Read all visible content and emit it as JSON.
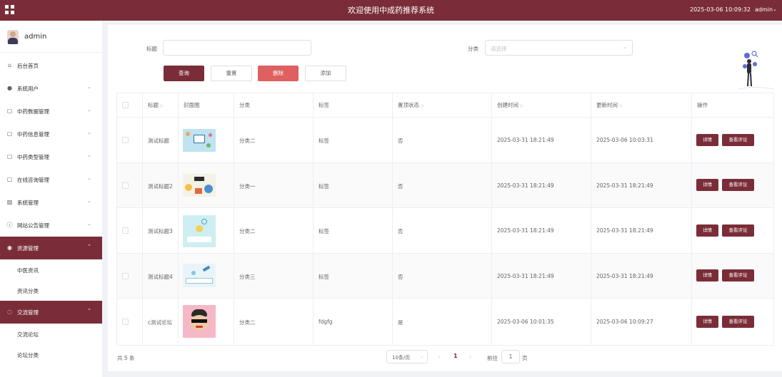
{
  "header": {
    "title": "欢迎使用中成药推荐系统",
    "datetime": "2025-03-06 10:09:32",
    "user": "admin",
    "user_caret": "⌄"
  },
  "sidebar": {
    "username": "admin",
    "items": [
      {
        "label": "后台首页",
        "icon": "home-icon",
        "glyph": "⌂",
        "arrow": ""
      },
      {
        "label": "系统用户",
        "icon": "user-icon",
        "glyph": "●",
        "arrow": "⌄"
      },
      {
        "label": "中药数据管理",
        "icon": "doc-icon",
        "glyph": "▢",
        "arrow": "⌄"
      },
      {
        "label": "中药信息管理",
        "icon": "doc-icon",
        "glyph": "▢",
        "arrow": "⌄"
      },
      {
        "label": "中药类型管理",
        "icon": "doc-icon",
        "glyph": "▢",
        "arrow": "⌄"
      },
      {
        "label": "在线咨询管理",
        "icon": "doc-icon",
        "glyph": "▢",
        "arrow": "⌄"
      },
      {
        "label": "系统管理",
        "icon": "chart-icon",
        "glyph": "▨",
        "arrow": "⌄"
      },
      {
        "label": "网站公告管理",
        "icon": "info-icon",
        "glyph": "ⓘ",
        "arrow": "⌄"
      },
      {
        "label": "资源管理",
        "icon": "location-icon",
        "glyph": "◉",
        "arrow": "⌃",
        "active": true
      },
      {
        "label": "中医资讯",
        "sub": true
      },
      {
        "label": "资讯分类",
        "sub": true
      },
      {
        "label": "交流管理",
        "icon": "chat-icon",
        "glyph": "◌",
        "arrow": "⌃",
        "active": true
      },
      {
        "label": "交流论坛",
        "sub": true
      },
      {
        "label": "论坛分类",
        "sub": true
      }
    ]
  },
  "search": {
    "title_label": "标题",
    "title_value": "",
    "category_label": "分类",
    "category_placeholder": "请选择"
  },
  "toolbar": {
    "query": "查询",
    "reset": "重置",
    "delete": "删除",
    "add": "添加"
  },
  "table": {
    "headers": {
      "title": "标题",
      "cover": "封面图",
      "category": "分类",
      "tags": "标签",
      "top": "置顶状态",
      "created": "创建时间",
      "updated": "更新时间",
      "actions": "操作"
    },
    "rows": [
      {
        "title": "测试标题",
        "category": "分类二",
        "tags": "标签",
        "top": "否",
        "created": "2025-03-31 18:21:49",
        "updated": "2025-03-06 10:03:31"
      },
      {
        "title": "测试标题2",
        "category": "分类一",
        "tags": "标签",
        "top": "否",
        "created": "2025-03-31 18:21:49",
        "updated": "2025-03-31 18:21:49"
      },
      {
        "title": "测试标题3",
        "category": "分类二",
        "tags": "标签",
        "top": "否",
        "created": "2025-03-31 18:21:49",
        "updated": "2025-03-31 18:21:49"
      },
      {
        "title": "测试标题4",
        "category": "分类三",
        "tags": "标签",
        "top": "否",
        "created": "2025-03-31 18:21:49",
        "updated": "2025-03-31 18:21:49"
      },
      {
        "title": "c测试论坛",
        "category": "分类二",
        "tags": "fdgfg",
        "top": "是",
        "created": "2025-03-06 10:01:35",
        "updated": "2025-03-06 10:09:27"
      }
    ],
    "detail_btn": "详情",
    "comments_btn": "查看评论"
  },
  "pagination": {
    "total": "共 5 条",
    "page_size": "10条/页",
    "prev": "‹",
    "next": "›",
    "current": "1",
    "goto": "前往",
    "goto_value": "1",
    "page_unit": "页"
  },
  "colors": {
    "brand": "#7a2d38",
    "danger": "#de6060"
  }
}
